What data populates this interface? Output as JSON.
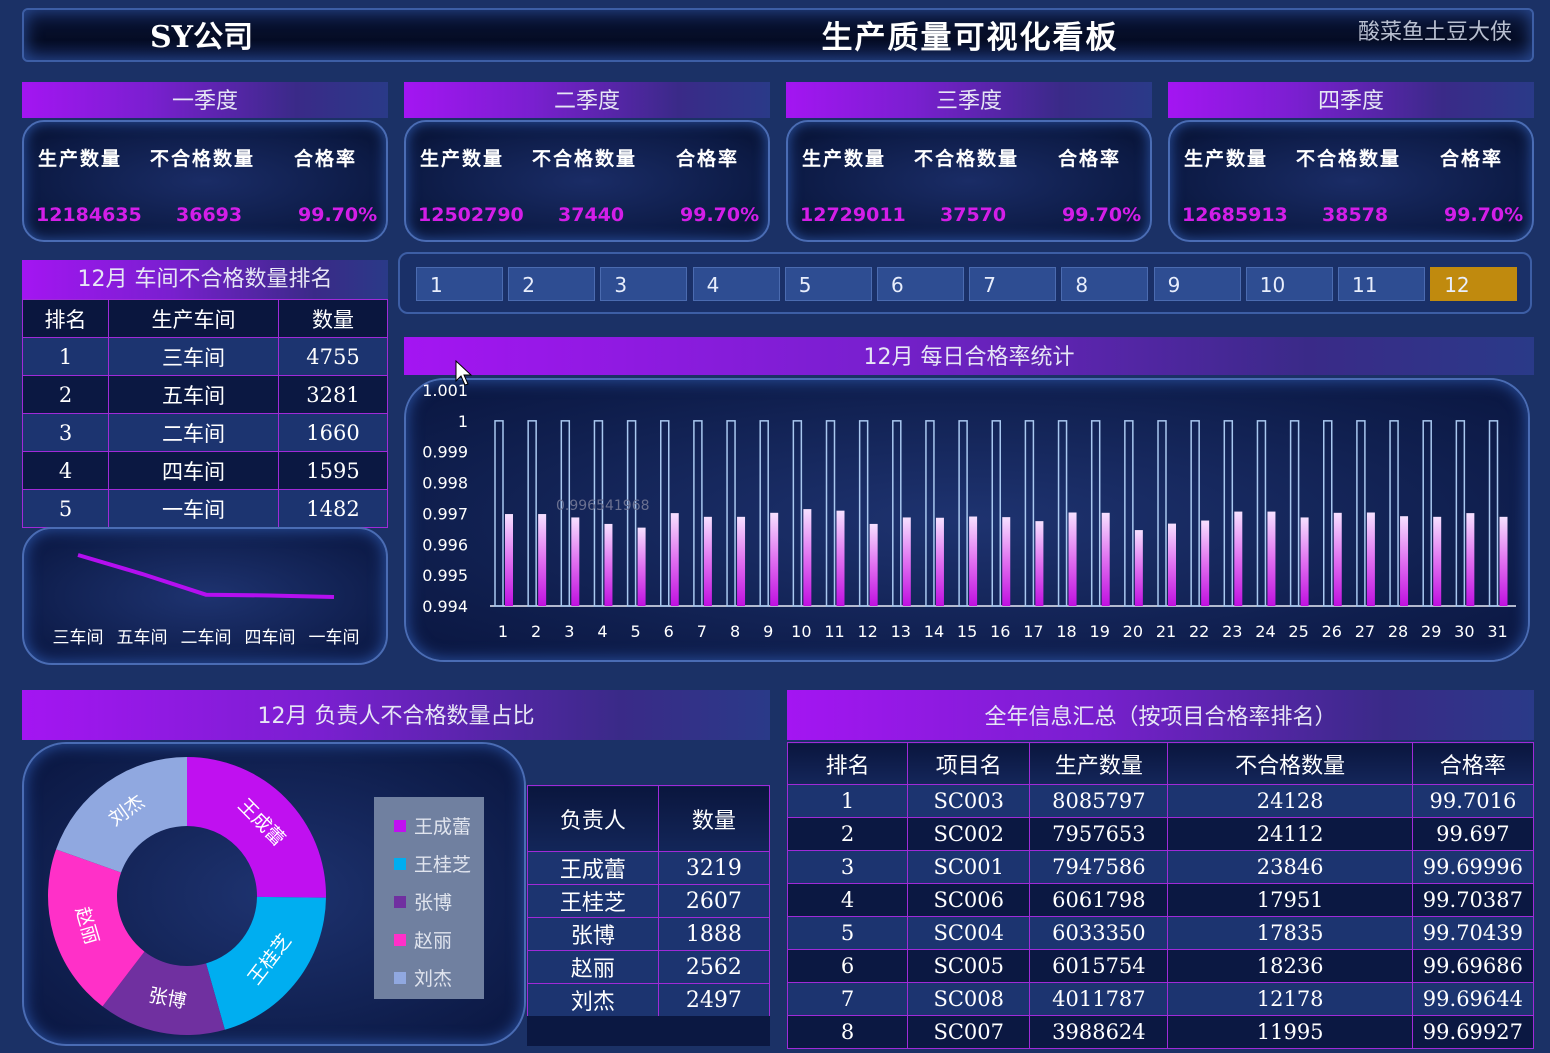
{
  "header": {
    "company": "SY公司",
    "title": "生产质量可视化看板",
    "author": "酸菜鱼土豆大侠"
  },
  "quarters": [
    {
      "name": "一季度",
      "production": "12184635",
      "defects": "36693",
      "pass_rate": "99.70%"
    },
    {
      "name": "二季度",
      "production": "12502790",
      "defects": "37440",
      "pass_rate": "99.70%"
    },
    {
      "name": "三季度",
      "production": "12729011",
      "defects": "37570",
      "pass_rate": "99.70%"
    },
    {
      "name": "四季度",
      "production": "12685913",
      "defects": "38578",
      "pass_rate": "99.70%"
    }
  ],
  "quarter_labels": {
    "production": "生产数量",
    "defects": "不合格数量",
    "pass_rate": "合格率"
  },
  "workshop_rank": {
    "title": "12月  车间不合格数量排名",
    "headers": [
      "排名",
      "生产车间",
      "数量"
    ],
    "rows": [
      [
        "1",
        "三车间",
        "4755"
      ],
      [
        "2",
        "五车间",
        "3281"
      ],
      [
        "3",
        "二车间",
        "1660"
      ],
      [
        "4",
        "四车间",
        "1595"
      ],
      [
        "5",
        "一车间",
        "1482"
      ]
    ]
  },
  "month_tabs": {
    "items": [
      "1",
      "2",
      "3",
      "4",
      "5",
      "6",
      "7",
      "8",
      "9",
      "10",
      "11",
      "12"
    ],
    "active": "12"
  },
  "daily_chart": {
    "title": "12月  每日合格率统计",
    "tooltip": "0.996541968"
  },
  "person_chart": {
    "title": "12月  负责人不合格数量占比"
  },
  "person_table": {
    "headers": [
      "负责人",
      "数量"
    ],
    "rows": [
      [
        "王成蕾",
        "3219"
      ],
      [
        "王桂芝",
        "2607"
      ],
      [
        "张博",
        "1888"
      ],
      [
        "赵丽",
        "2562"
      ],
      [
        "刘杰",
        "2497"
      ]
    ]
  },
  "summary": {
    "title": "全年信息汇总（按项目合格率排名）",
    "headers": [
      "排名",
      "项目名",
      "生产数量",
      "不合格数量",
      "合格率"
    ],
    "rows": [
      [
        "1",
        "SC003",
        "8085797",
        "24128",
        "99.7016"
      ],
      [
        "2",
        "SC002",
        "7957653",
        "24112",
        "99.697"
      ],
      [
        "3",
        "SC001",
        "7947586",
        "23846",
        "99.69996"
      ],
      [
        "4",
        "SC006",
        "6061798",
        "17951",
        "99.70387"
      ],
      [
        "5",
        "SC004",
        "6033350",
        "17835",
        "99.70439"
      ],
      [
        "6",
        "SC005",
        "6015754",
        "18236",
        "99.69686"
      ],
      [
        "7",
        "SC008",
        "4011787",
        "12178",
        "99.69644"
      ],
      [
        "8",
        "SC007",
        "3988624",
        "11995",
        "99.69927"
      ]
    ]
  },
  "colors": {
    "background": "#1b3166",
    "accent_purple": "#a415f2",
    "value_magenta": "#d31ee8",
    "tab_active": "#c08a0e",
    "bar_outline": "#a9c8f0",
    "pie": [
      "#c010f0",
      "#00aef0",
      "#7030a0",
      "#ff30c8",
      "#90a8e0"
    ]
  },
  "chart_data": [
    {
      "type": "line",
      "categories": [
        "三车间",
        "五车间",
        "二车间",
        "四车间",
        "一车间"
      ],
      "series": [
        {
          "values": [
            4755,
            3281,
            1660,
            1595,
            1482
          ]
        }
      ],
      "title": "",
      "xlabel": "",
      "ylabel": ""
    },
    {
      "type": "bar",
      "title": "12月  每日合格率统计",
      "categories": [
        "1",
        "2",
        "3",
        "4",
        "5",
        "6",
        "7",
        "8",
        "9",
        "10",
        "11",
        "12",
        "13",
        "14",
        "15",
        "16",
        "17",
        "18",
        "19",
        "20",
        "21",
        "22",
        "23",
        "24",
        "25",
        "26",
        "27",
        "28",
        "29",
        "30",
        "31"
      ],
      "series": [
        {
          "values": [
            1,
            1,
            1,
            1,
            1,
            1,
            1,
            1,
            1,
            1,
            1,
            1,
            1,
            1,
            1,
            1,
            1,
            1,
            1,
            1,
            1,
            1,
            1,
            1,
            1,
            1,
            1,
            1,
            1,
            1,
            1
          ]
        },
        {
          "values": [
            0.99698,
            0.99698,
            0.99687,
            0.99666,
            0.99654,
            0.99701,
            0.99689,
            0.99689,
            0.99702,
            0.99714,
            0.99709,
            0.99666,
            0.99687,
            0.99686,
            0.9969,
            0.99688,
            0.99675,
            0.99703,
            0.99702,
            0.99646,
            0.99667,
            0.99677,
            0.99706,
            0.99706,
            0.99687,
            0.99702,
            0.99703,
            0.99691,
            0.99689,
            0.99701,
            0.99689
          ]
        }
      ],
      "yticks": [
        "0.994",
        "0.995",
        "0.996",
        "0.997",
        "0.998",
        "0.999",
        "1",
        "1.001"
      ],
      "ylim": [
        0.994,
        1.001
      ],
      "grid": false
    },
    {
      "type": "pie",
      "title": "12月  负责人不合格数量占比",
      "categories": [
        "王成蕾",
        "王桂芝",
        "张博",
        "赵丽",
        "刘杰"
      ],
      "values": [
        3219,
        2607,
        1888,
        2562,
        2497
      ],
      "legend": "right"
    }
  ]
}
